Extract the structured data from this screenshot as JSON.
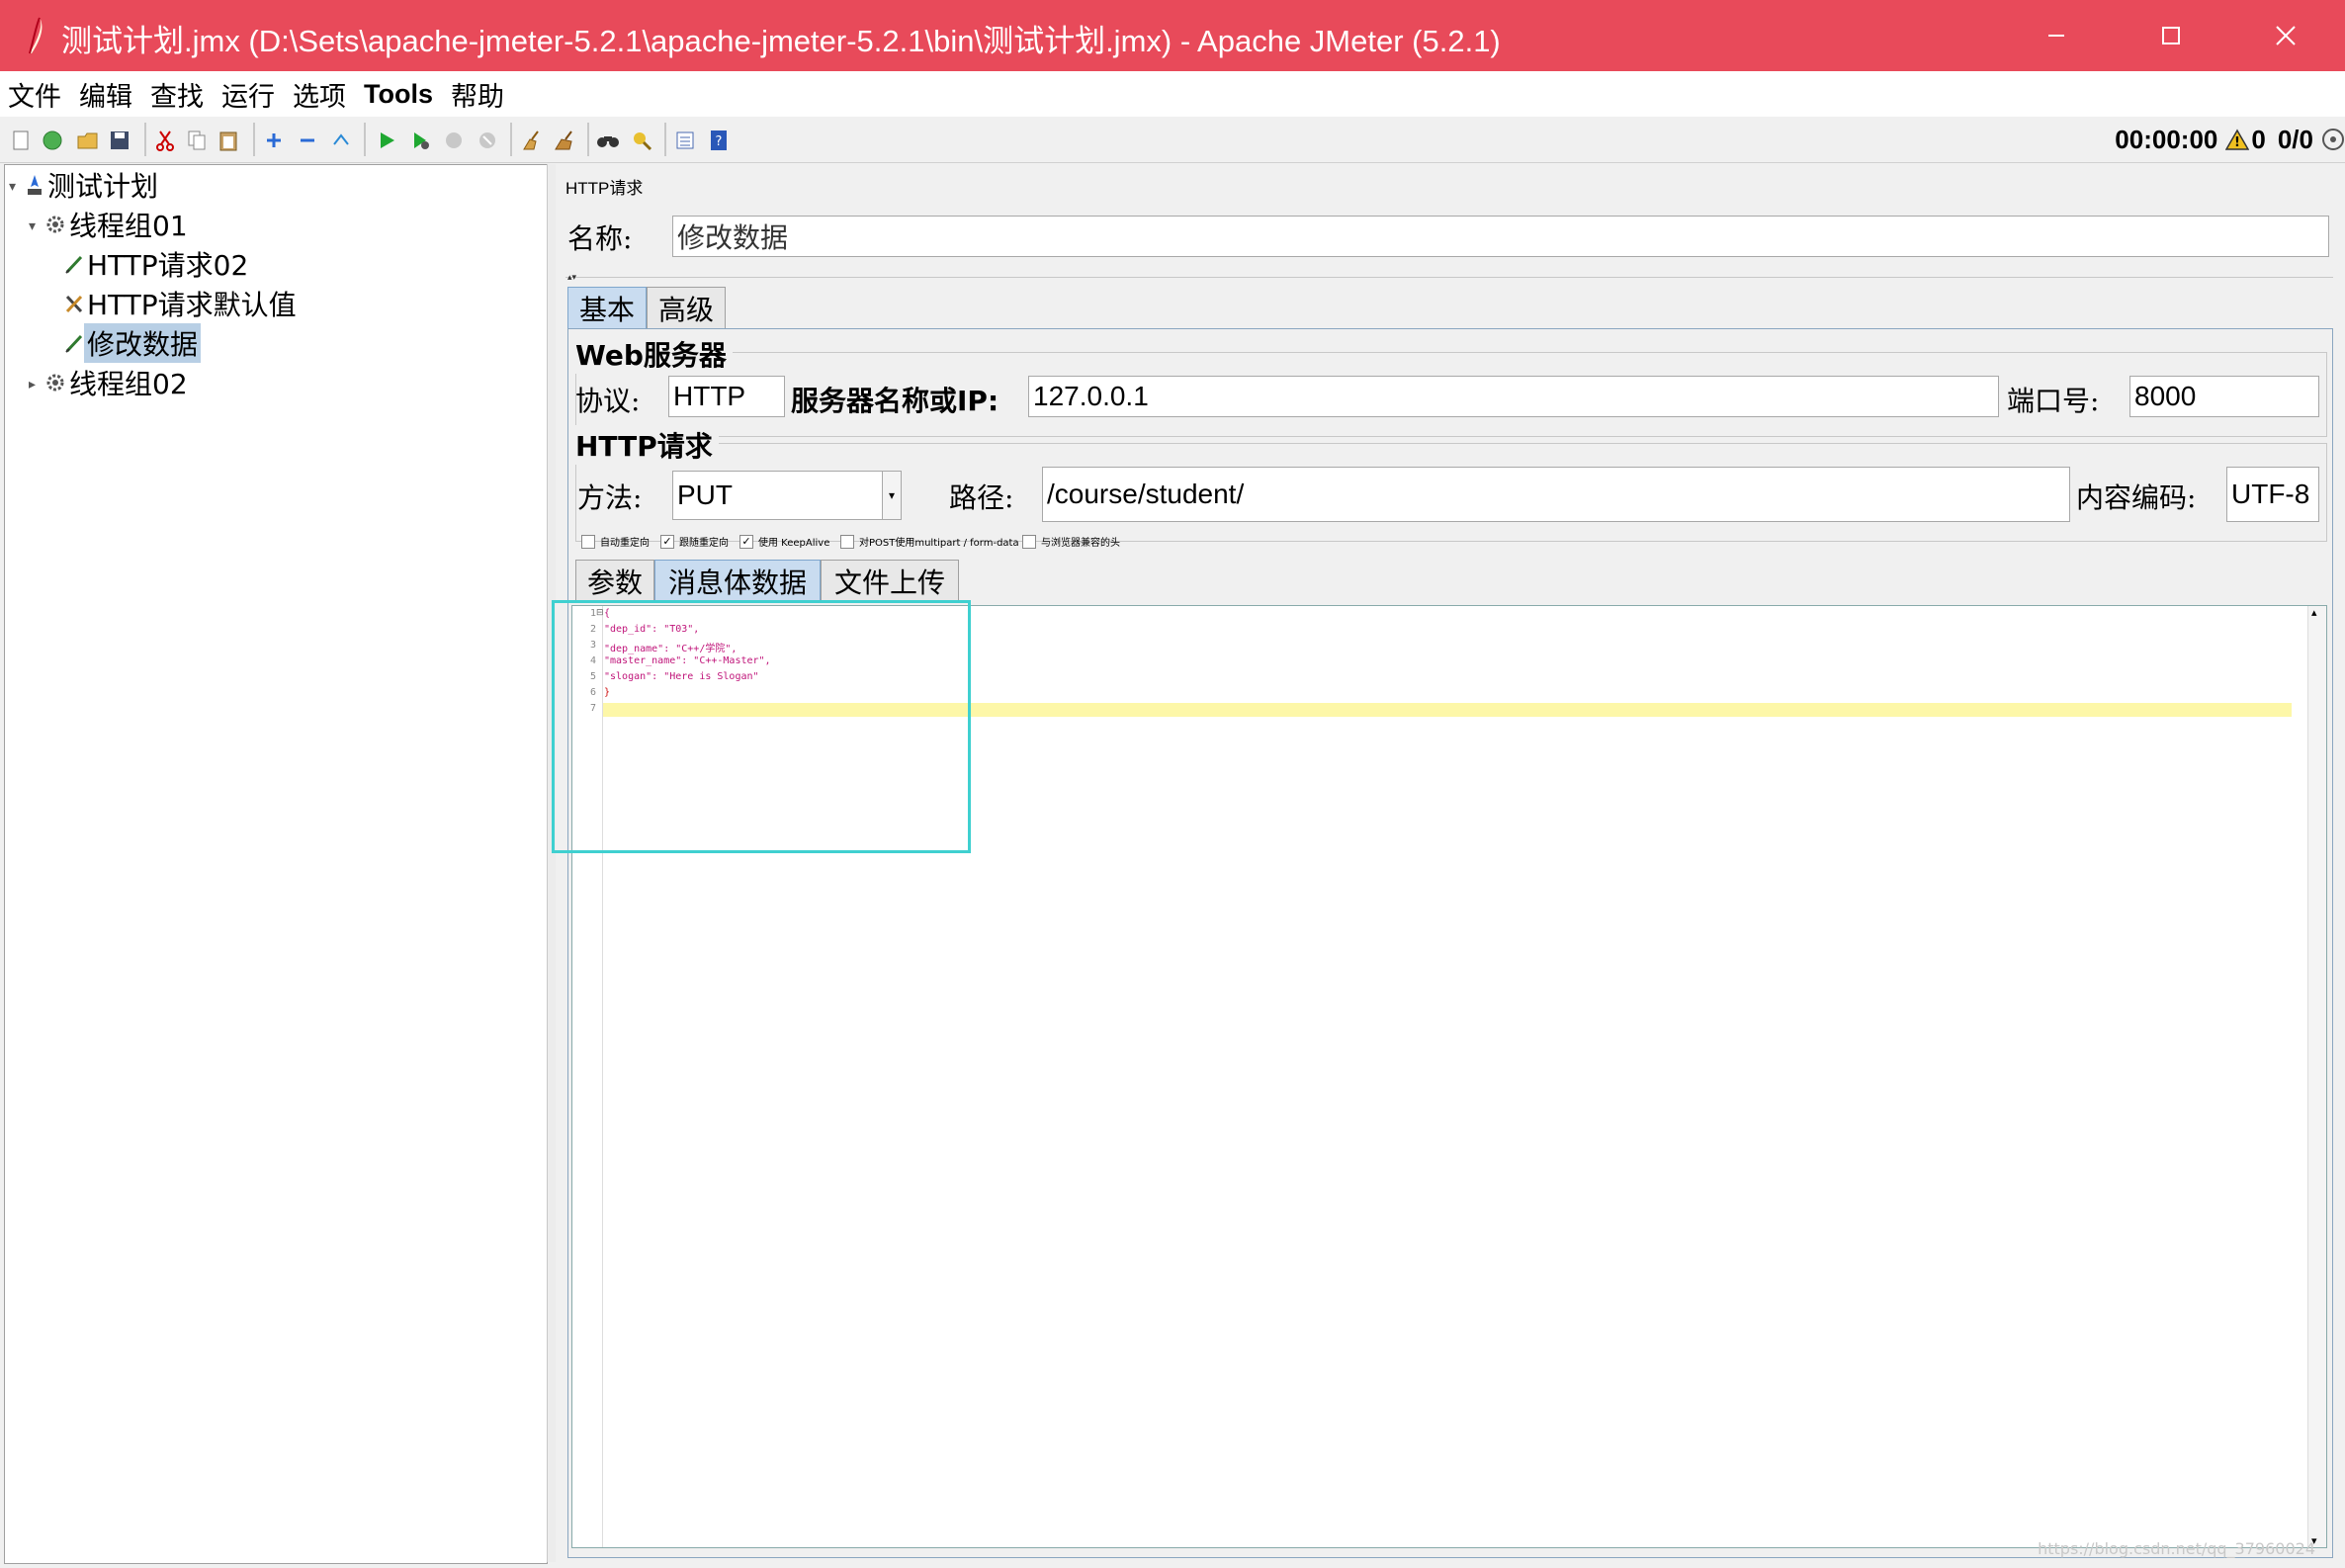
{
  "window": {
    "title": "测试计划.jmx (D:\\Sets\\apache-jmeter-5.2.1\\apache-jmeter-5.2.1\\bin\\测试计划.jmx) - Apache JMeter (5.2.1)",
    "accent": "#e84a5a"
  },
  "menu": [
    "文件",
    "编辑",
    "查找",
    "运行",
    "选项",
    "Tools",
    "帮助"
  ],
  "status": {
    "timer": "00:00:00",
    "warnings": "0",
    "threads": "0/0"
  },
  "tree": {
    "root": "测试计划",
    "group1": "线程组01",
    "item1": "HTTP请求02",
    "item2": "HTTP请求默认值",
    "item3": "修改数据",
    "group2": "线程组02"
  },
  "panel": {
    "header": "HTTP请求",
    "name_label": "名称:",
    "name_value": "修改数据",
    "tabs": [
      "基本",
      "高级"
    ],
    "web_server_title": "Web服务器",
    "protocol_label": "协议:",
    "protocol_value": "HTTP",
    "server_label": "服务器名称或IP:",
    "server_value": "127.0.0.1",
    "port_label": "端口号:",
    "port_value": "8000",
    "http_request_title": "HTTP请求",
    "method_label": "方法:",
    "method_value": "PUT",
    "path_label": "路径:",
    "path_value": "/course/student/",
    "encoding_label": "内容编码:",
    "encoding_value": "UTF-8",
    "checkboxes": [
      {
        "label": "自动重定向",
        "checked": false
      },
      {
        "label": "跟随重定向",
        "checked": true
      },
      {
        "label": "使用 KeepAlive",
        "checked": true
      },
      {
        "label": "对POST使用multipart / form-data",
        "checked": false
      },
      {
        "label": "与浏览器兼容的头",
        "checked": false
      }
    ],
    "body_tabs": [
      "参数",
      "消息体数据",
      "文件上传"
    ]
  },
  "editor": {
    "line_numbers": [
      "1",
      "2",
      "3",
      "4",
      "5",
      "6",
      "7"
    ],
    "lines": [
      "{",
      "\"dep_id\": \"T03\",",
      "\"dep_name\": \"C++/学院\",",
      "\"master_name\": \"C++-Master\",",
      "\"slogan\": \"Here is Slogan\"",
      "}",
      ""
    ]
  },
  "watermark": "https://blog.csdn.net/qq_37960024"
}
